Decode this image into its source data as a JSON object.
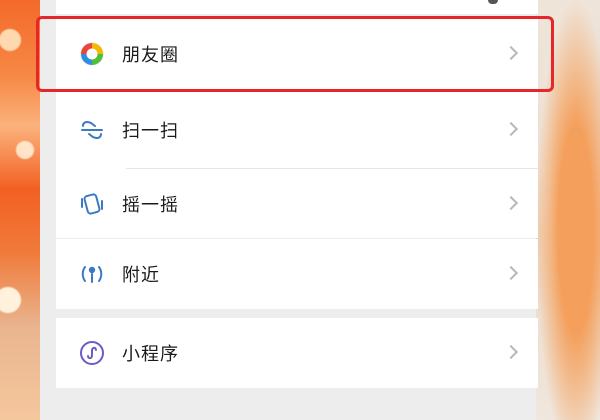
{
  "menu": {
    "moments": {
      "label": "朋友圈",
      "icon": "moments-icon"
    },
    "scan": {
      "label": "扫一扫",
      "icon": "scan-icon"
    },
    "shake": {
      "label": "摇一摇",
      "icon": "shake-icon"
    },
    "nearby": {
      "label": "附近",
      "icon": "nearby-icon"
    },
    "mini_programs": {
      "label": "小程序",
      "icon": "mini-program-icon"
    }
  },
  "colors": {
    "highlight": "#e6262a",
    "icon_blue": "#3a78c8",
    "icon_purple": "#6a5bc7"
  }
}
